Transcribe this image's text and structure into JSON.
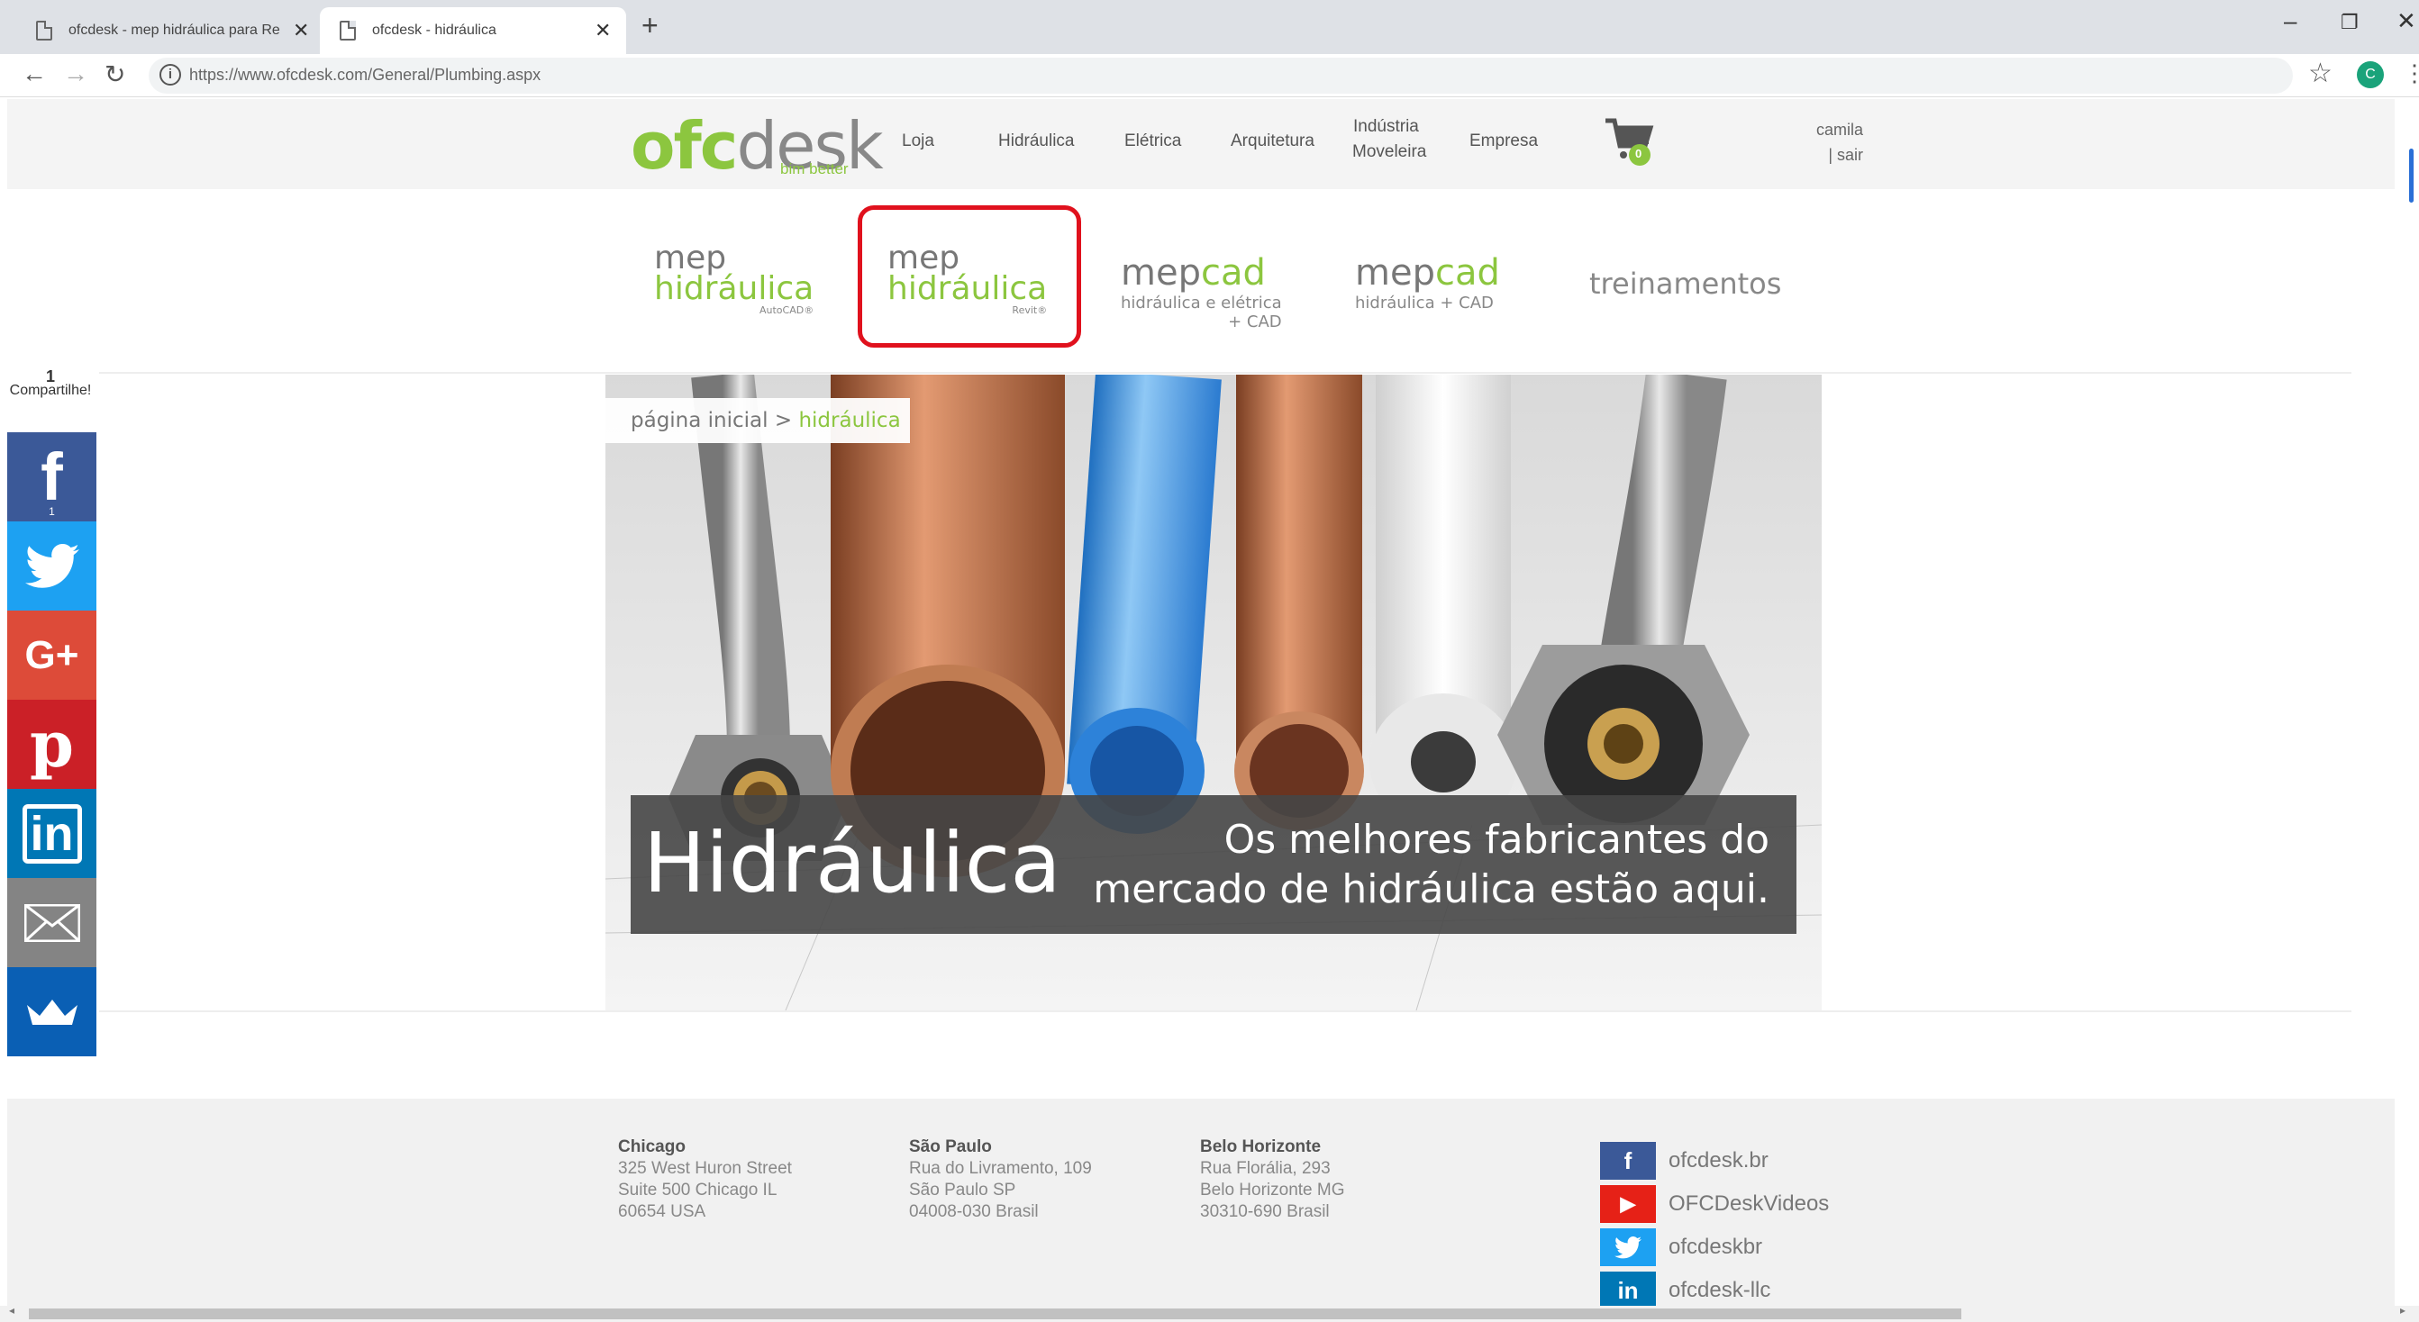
{
  "browser": {
    "tabs": [
      {
        "title": "ofcdesk - mep hidráulica para Re"
      },
      {
        "title": "ofcdesk - hidráulica"
      }
    ],
    "url": "https://www.ofcdesk.com/General/Plumbing.aspx",
    "profile_initial": "C"
  },
  "header": {
    "logo_ofc": "ofc",
    "logo_desk": "desk",
    "tagline": "bim better",
    "nav": [
      "Loja",
      "Hidráulica",
      "Elétrica",
      "Arquitetura",
      "Indústria",
      "Moveleira",
      "Empresa"
    ],
    "cart_count": "0",
    "user": "camila",
    "logout": "| sair"
  },
  "products": {
    "p1": {
      "line1": "mep",
      "line2": "hidráulica",
      "sub": "AutoCAD®"
    },
    "p2": {
      "line1": "mep",
      "line2": "hidráulica",
      "sub": "Revit®"
    },
    "p3": {
      "a": "mep",
      "b": "cad",
      "sub1": "hidráulica e elétrica",
      "sub2": "+ CAD"
    },
    "p4": {
      "a": "mep",
      "b": "cad",
      "sub1": "hidráulica + CAD"
    },
    "p5": "treinamentos"
  },
  "breadcrumb": {
    "home": "página inicial",
    "sep": ">",
    "current": "hidráulica"
  },
  "hero": {
    "title": "Hidráulica",
    "text1": "Os melhores fabricantes do",
    "text2": "mercado de hidráulica estão aqui."
  },
  "share": {
    "count": "1",
    "label": "Compartilhe!",
    "fb_count": "1"
  },
  "footer": {
    "offices": [
      {
        "city": "Chicago",
        "l1": "325 West Huron Street",
        "l2": "Suite 500 Chicago IL",
        "l3": "60654 USA"
      },
      {
        "city": "São Paulo",
        "l1": "Rua do Livramento, 109",
        "l2": "São Paulo SP",
        "l3": "04008-030 Brasil"
      },
      {
        "city": "Belo Horizonte",
        "l1": "Rua Florália, 293",
        "l2": "Belo Horizonte MG",
        "l3": "30310-690 Brasil"
      }
    ],
    "social": [
      {
        "icon": "facebook-icon",
        "label": "ofcdesk.br"
      },
      {
        "icon": "youtube-icon",
        "label": "OFCDeskVideos"
      },
      {
        "icon": "twitter-icon",
        "label": "ofcdeskbr"
      },
      {
        "icon": "linkedin-icon",
        "label": "ofcdesk-llc"
      }
    ]
  },
  "colors": {
    "brand_green": "#8cc63f",
    "highlight_red": "#e0111d",
    "facebook": "#3b5998",
    "twitter": "#1da1f2",
    "google": "#dd4b39",
    "pinterest": "#cb2027",
    "linkedin": "#0077b5",
    "youtube": "#e62117"
  }
}
